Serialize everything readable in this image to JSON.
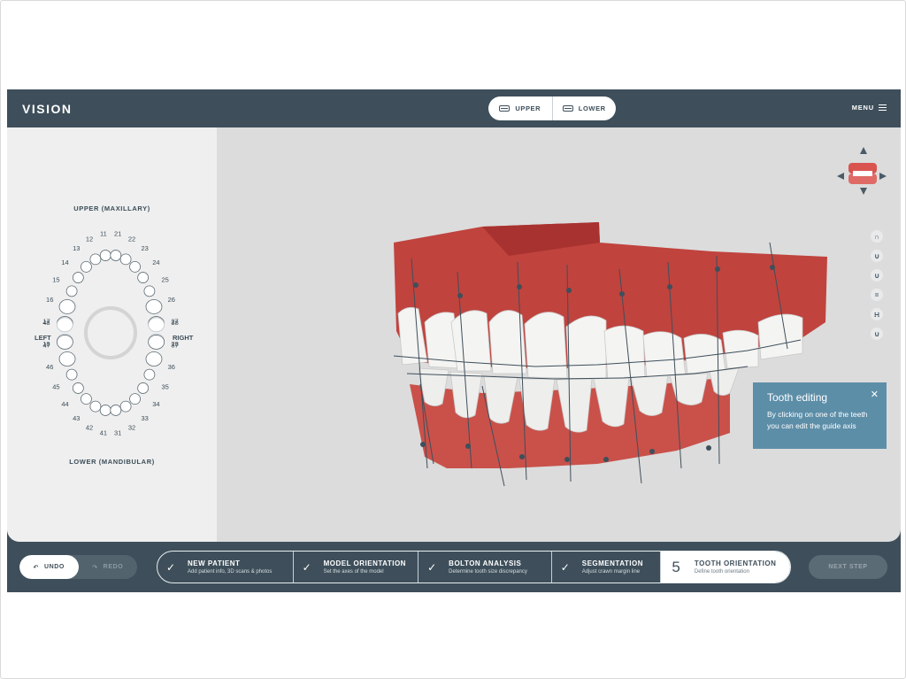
{
  "app": {
    "logo": "VISION"
  },
  "jaw_toggle": {
    "upper_label": "UPPER",
    "lower_label": "LOWER"
  },
  "menu": {
    "label": "MENU"
  },
  "tooth_chart": {
    "upper_label": "UPPER (MAXILLARY)",
    "lower_label": "LOWER (MANDIBULAR)",
    "left_label": "LEFT",
    "right_label": "RIGHT",
    "upper_numbers": [
      "18",
      "17",
      "16",
      "15",
      "14",
      "13",
      "12",
      "11",
      "21",
      "22",
      "23",
      "24",
      "25",
      "26",
      "27",
      "28"
    ],
    "lower_numbers": [
      "48",
      "47",
      "46",
      "45",
      "44",
      "43",
      "42",
      "41",
      "31",
      "32",
      "33",
      "34",
      "35",
      "36",
      "37",
      "38"
    ]
  },
  "tooltip": {
    "title": "Tooth editing",
    "body": "By clicking on one of the teeth you can edit the guide axis",
    "close": "✕"
  },
  "side_toolbar": {
    "icons": [
      "upper-arch-icon",
      "lower-arch-icon",
      "front-view-icon",
      "side-view-icon",
      "split-view-icon",
      "occlusal-view-icon"
    ]
  },
  "bottom": {
    "undo_label": "UNDO",
    "redo_label": "REDO",
    "next_label": "NEXT STEP",
    "steps": [
      {
        "title": "NEW PATIENT",
        "subtitle": "Add patient info, 3D scans & photos",
        "status": "done"
      },
      {
        "title": "MODEL ORIENTATION",
        "subtitle": "Set the axes of the model",
        "status": "done"
      },
      {
        "title": "BOLTON ANALYSIS",
        "subtitle": "Determine tooth size discrepancy",
        "status": "done"
      },
      {
        "title": "SEGMENTATION",
        "subtitle": "Adjust crawn margin line",
        "status": "done"
      },
      {
        "title": "TOOTH ORIENTATION",
        "subtitle": "Define tooth orientation",
        "status": "active",
        "number": "5"
      }
    ]
  },
  "colors": {
    "header": "#3e4f5b",
    "viewport": "#dcdcdc",
    "panel": "#efefef",
    "tooltip": "#5d8ea8",
    "gum": "#c0403d",
    "teeth": "#f2f2f0"
  }
}
